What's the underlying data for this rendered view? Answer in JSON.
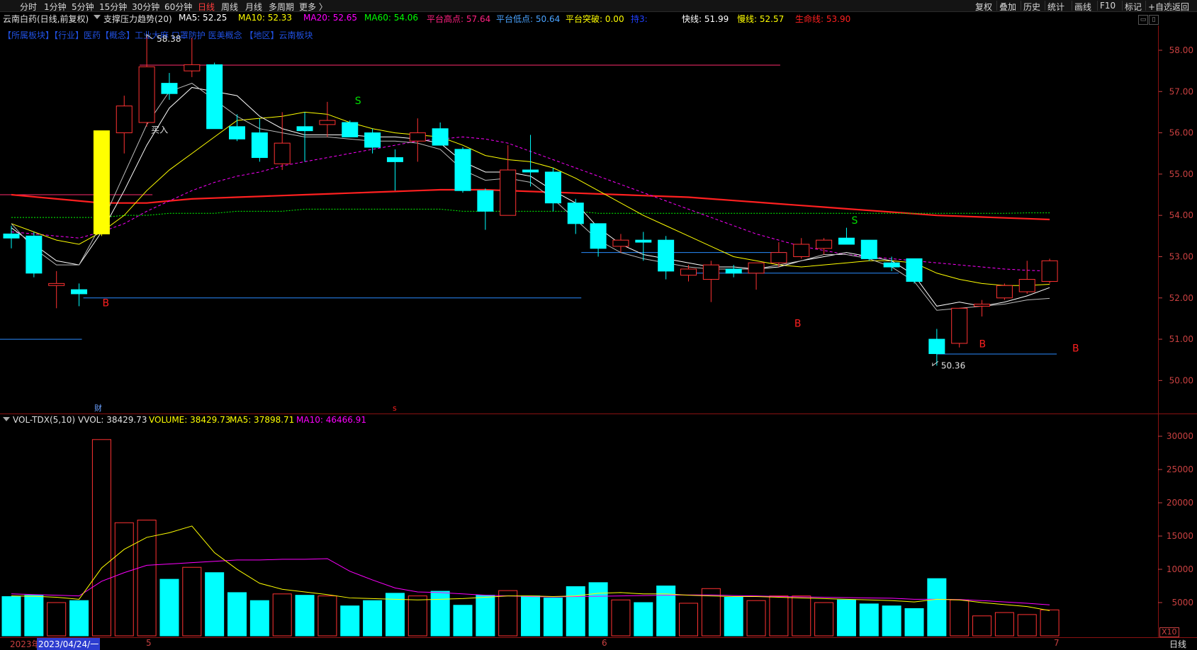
{
  "toolbar": {
    "left": [
      "分时",
      "1分钟",
      "5分钟",
      "15分钟",
      "30分钟",
      "60分钟",
      "日线",
      "周线",
      "月线",
      "多周期",
      "更多 〉"
    ],
    "active": "日线",
    "right": [
      "复权",
      "叠加",
      "历史",
      "统计",
      "画线",
      "F10",
      "标记",
      "+自选",
      "返回"
    ]
  },
  "infobar": {
    "name": "云南白药(日线,前复权)",
    "indicator": "支撑压力趋势(20)",
    "ma5": "MA5: 52.25",
    "ma10": "MA10: 52.33",
    "ma20": "MA20: 52.65",
    "ma60": "MA60: 54.06",
    "plat_high": "平台高点: 57.64",
    "plat_low": "平台低点: 50.64",
    "plat_break": "平台突破: 0.00",
    "extra": "持3:",
    "fast": "快线: 51.99",
    "slow": "慢线: 52.57",
    "life": "生命线: 53.90"
  },
  "tags": "【所属板块】【行业】医药【概念】工业大麻 口罩防护 医美概念 【地区】云南板块",
  "colors": {
    "up": "#ff3232",
    "down": "#00ffff",
    "ma5": "#ffffff",
    "ma10": "#ffff00",
    "ma20": "#ff00ff",
    "ma60": "#00ff00",
    "life": "#ff2020",
    "axis": "#c84040"
  },
  "chart_data": [
    {
      "type": "candlestick",
      "title": "云南白药(日线,前复权)",
      "ylim": [
        49.2,
        58.6
      ],
      "yticks": [
        50.0,
        51.0,
        52.0,
        53.0,
        54.0,
        55.0,
        56.0,
        57.0,
        58.0
      ],
      "candles": [
        {
          "o": 53.55,
          "h": 53.75,
          "l": 53.2,
          "c": 53.45
        },
        {
          "o": 53.5,
          "h": 53.6,
          "l": 52.5,
          "c": 52.6
        },
        {
          "o": 52.3,
          "h": 52.65,
          "l": 51.75,
          "c": 52.35
        },
        {
          "o": 52.2,
          "h": 52.35,
          "l": 51.8,
          "c": 52.1
        },
        {
          "o": 53.55,
          "h": 56.05,
          "l": 53.5,
          "c": 56.05
        },
        {
          "o": 56.0,
          "h": 56.9,
          "l": 55.5,
          "c": 56.65
        },
        {
          "o": 56.25,
          "h": 58.38,
          "l": 56.15,
          "c": 57.6
        },
        {
          "o": 57.2,
          "h": 57.45,
          "l": 56.8,
          "c": 56.95
        },
        {
          "o": 57.5,
          "h": 58.3,
          "l": 57.35,
          "c": 57.65
        },
        {
          "o": 57.65,
          "h": 57.7,
          "l": 56.1,
          "c": 56.1
        },
        {
          "o": 56.15,
          "h": 56.45,
          "l": 55.8,
          "c": 55.85
        },
        {
          "o": 56.0,
          "h": 56.35,
          "l": 55.3,
          "c": 55.4
        },
        {
          "o": 55.25,
          "h": 56.5,
          "l": 55.1,
          "c": 55.75
        },
        {
          "o": 56.15,
          "h": 56.5,
          "l": 55.3,
          "c": 56.05
        },
        {
          "o": 56.2,
          "h": 56.75,
          "l": 55.9,
          "c": 56.3
        },
        {
          "o": 56.25,
          "h": 56.3,
          "l": 55.9,
          "c": 55.9
        },
        {
          "o": 56.0,
          "h": 56.1,
          "l": 55.5,
          "c": 55.65
        },
        {
          "o": 55.4,
          "h": 55.6,
          "l": 54.6,
          "c": 55.3
        },
        {
          "o": 55.8,
          "h": 56.35,
          "l": 55.3,
          "c": 56.0
        },
        {
          "o": 56.1,
          "h": 56.25,
          "l": 55.7,
          "c": 55.7
        },
        {
          "o": 55.6,
          "h": 55.65,
          "l": 54.55,
          "c": 54.6
        },
        {
          "o": 54.6,
          "h": 54.65,
          "l": 53.65,
          "c": 54.1
        },
        {
          "o": 54.0,
          "h": 55.7,
          "l": 54.0,
          "c": 55.1
        },
        {
          "o": 55.1,
          "h": 55.95,
          "l": 54.7,
          "c": 55.05
        },
        {
          "o": 55.05,
          "h": 55.15,
          "l": 54.1,
          "c": 54.3
        },
        {
          "o": 54.3,
          "h": 54.4,
          "l": 53.55,
          "c": 53.8
        },
        {
          "o": 53.8,
          "h": 53.8,
          "l": 53.0,
          "c": 53.2
        },
        {
          "o": 53.25,
          "h": 53.55,
          "l": 53.1,
          "c": 53.4
        },
        {
          "o": 53.4,
          "h": 53.6,
          "l": 52.9,
          "c": 53.35
        },
        {
          "o": 53.4,
          "h": 53.5,
          "l": 52.45,
          "c": 52.65
        },
        {
          "o": 52.55,
          "h": 52.8,
          "l": 52.4,
          "c": 52.7
        },
        {
          "o": 52.45,
          "h": 52.9,
          "l": 51.9,
          "c": 52.8
        },
        {
          "o": 52.7,
          "h": 52.8,
          "l": 52.5,
          "c": 52.6
        },
        {
          "o": 52.6,
          "h": 52.85,
          "l": 52.2,
          "c": 52.85
        },
        {
          "o": 52.85,
          "h": 53.35,
          "l": 52.75,
          "c": 53.1
        },
        {
          "o": 53.0,
          "h": 53.45,
          "l": 52.95,
          "c": 53.3
        },
        {
          "o": 53.2,
          "h": 53.45,
          "l": 53.05,
          "c": 53.4
        },
        {
          "o": 53.45,
          "h": 53.7,
          "l": 53.3,
          "c": 53.3
        },
        {
          "o": 53.4,
          "h": 53.4,
          "l": 52.9,
          "c": 52.95
        },
        {
          "o": 52.85,
          "h": 53.0,
          "l": 52.65,
          "c": 52.75
        },
        {
          "o": 52.95,
          "h": 52.95,
          "l": 52.35,
          "c": 52.4
        },
        {
          "o": 51.0,
          "h": 51.25,
          "l": 50.36,
          "c": 50.65
        },
        {
          "o": 50.9,
          "h": 51.75,
          "l": 50.8,
          "c": 51.75
        },
        {
          "o": 51.8,
          "h": 51.95,
          "l": 51.55,
          "c": 51.85
        },
        {
          "o": 52.0,
          "h": 52.35,
          "l": 51.95,
          "c": 52.3
        },
        {
          "o": 52.15,
          "h": 52.9,
          "l": 52.1,
          "c": 52.45
        },
        {
          "o": 52.4,
          "h": 52.95,
          "l": 52.35,
          "c": 52.9
        }
      ],
      "ma5": [
        53.7,
        53.3,
        52.9,
        52.8,
        53.6,
        54.6,
        55.7,
        56.6,
        57.1,
        57.0,
        56.9,
        56.4,
        56.1,
        55.95,
        55.95,
        55.95,
        55.9,
        55.9,
        55.85,
        55.75,
        55.3,
        55.05,
        55.05,
        54.95,
        54.6,
        54.3,
        53.7,
        53.3,
        53.05,
        52.95,
        52.85,
        52.75,
        52.75,
        52.7,
        52.75,
        52.9,
        53.0,
        53.1,
        53.0,
        52.9,
        52.55,
        51.8,
        51.9,
        51.8,
        51.9,
        52.05,
        52.25
      ],
      "ma10": [
        53.8,
        53.6,
        53.4,
        53.3,
        53.6,
        54.0,
        54.6,
        55.1,
        55.5,
        55.9,
        56.3,
        56.35,
        56.4,
        56.5,
        56.45,
        56.25,
        56.1,
        56.0,
        55.95,
        55.9,
        55.7,
        55.45,
        55.35,
        55.3,
        55.15,
        54.9,
        54.6,
        54.3,
        54.0,
        53.75,
        53.5,
        53.25,
        53.0,
        52.9,
        52.8,
        52.75,
        52.8,
        52.85,
        52.9,
        52.9,
        52.85,
        52.6,
        52.45,
        52.35,
        52.3,
        52.3,
        52.33
      ],
      "ma20": [
        53.6,
        53.55,
        53.5,
        53.45,
        53.6,
        53.8,
        54.1,
        54.35,
        54.6,
        54.8,
        54.95,
        55.05,
        55.2,
        55.3,
        55.4,
        55.5,
        55.6,
        55.7,
        55.8,
        55.85,
        55.9,
        55.85,
        55.75,
        55.55,
        55.35,
        55.15,
        54.95,
        54.75,
        54.55,
        54.35,
        54.15,
        53.95,
        53.75,
        53.55,
        53.4,
        53.25,
        53.15,
        53.05,
        53.0,
        52.95,
        52.9,
        52.85,
        52.8,
        52.75,
        52.7,
        52.67,
        52.65
      ],
      "ma60": [
        53.95,
        53.95,
        53.95,
        53.95,
        53.95,
        54.0,
        54.0,
        54.05,
        54.05,
        54.05,
        54.1,
        54.1,
        54.1,
        54.15,
        54.15,
        54.15,
        54.15,
        54.15,
        54.15,
        54.15,
        54.1,
        54.1,
        54.1,
        54.1,
        54.1,
        54.1,
        54.05,
        54.05,
        54.05,
        54.05,
        54.05,
        54.05,
        54.05,
        54.05,
        54.05,
        54.05,
        54.05,
        54.05,
        54.05,
        54.05,
        54.05,
        54.05,
        54.05,
        54.05,
        54.05,
        54.06,
        54.06
      ],
      "fast": [
        53.8,
        53.2,
        52.8,
        52.8,
        53.8,
        55.0,
        56.2,
        57.0,
        57.2,
        56.8,
        56.4,
        56.1,
        56.0,
        55.9,
        55.9,
        55.85,
        55.8,
        55.8,
        55.75,
        55.6,
        55.1,
        54.85,
        54.9,
        54.8,
        54.4,
        53.9,
        53.4,
        53.1,
        52.95,
        52.85,
        52.75,
        52.7,
        52.7,
        52.7,
        52.8,
        52.9,
        53.05,
        53.05,
        52.95,
        52.75,
        52.4,
        51.7,
        51.75,
        51.8,
        51.85,
        51.95,
        51.99
      ],
      "life": [
        54.5,
        54.45,
        54.4,
        54.35,
        54.3,
        54.3,
        54.3,
        54.35,
        54.4,
        54.42,
        54.44,
        54.46,
        54.48,
        54.5,
        54.52,
        54.54,
        54.56,
        54.58,
        54.6,
        54.62,
        54.62,
        54.62,
        54.6,
        54.58,
        54.56,
        54.54,
        54.52,
        54.5,
        54.48,
        54.46,
        54.44,
        54.4,
        54.36,
        54.32,
        54.28,
        54.24,
        54.2,
        54.16,
        54.12,
        54.08,
        54.04,
        54.0,
        53.98,
        53.96,
        53.94,
        53.92,
        53.9
      ],
      "annotations": {
        "high": "58.38",
        "low": "50.36",
        "buy_text": "买入",
        "b": "B",
        "s": "S",
        "cai": "财",
        "s_red": "s"
      }
    },
    {
      "type": "bar",
      "title": "VOL-TDX(5,10)",
      "ylim": [
        0,
        31500
      ],
      "yticks": [
        5000,
        10000,
        15000,
        20000,
        25000,
        30000
      ],
      "volume": [
        5900,
        6100,
        5000,
        5300,
        29500,
        17000,
        17400,
        8500,
        10300,
        9500,
        6500,
        5300,
        6300,
        6100,
        6000,
        4500,
        5300,
        6400,
        6000,
        6700,
        4600,
        6100,
        6800,
        6000,
        5700,
        7400,
        8000,
        5400,
        5000,
        7500,
        4900,
        7100,
        5800,
        5300,
        6000,
        6000,
        5000,
        5400,
        4800,
        4500,
        4100,
        8600,
        5400,
        3000,
        3500,
        3200,
        3900
      ],
      "ma5": [
        6000,
        5950,
        5800,
        5500,
        10200,
        13000,
        14800,
        15500,
        16500,
        12500,
        10000,
        7900,
        7000,
        6600,
        6200,
        5700,
        5600,
        5500,
        5400,
        5500,
        5600,
        5800,
        6000,
        6000,
        5900,
        6000,
        6400,
        6500,
        6300,
        6300,
        6100,
        6000,
        5900,
        5900,
        5800,
        5700,
        5600,
        5500,
        5400,
        5300,
        5100,
        5500,
        5400,
        5000,
        4700,
        4400,
        3790
      ],
      "ma10": [
        6300,
        6200,
        6100,
        6000,
        8200,
        9500,
        10600,
        10800,
        11000,
        11200,
        11400,
        11400,
        11500,
        11500,
        11600,
        9700,
        8400,
        7200,
        6600,
        6500,
        6300,
        6100,
        6000,
        5900,
        5850,
        5900,
        5950,
        6000,
        6050,
        6100,
        6150,
        6150,
        6050,
        6000,
        5900,
        5850,
        5800,
        5750,
        5700,
        5650,
        5500,
        5500,
        5450,
        5300,
        5100,
        4900,
        4650
      ],
      "info": {
        "name": "VOL-TDX(5,10)",
        "vvol": "VVOL: 38429.73",
        "volume": "VOLUME: 38429.73",
        "ma5": "MA5: 37898.71",
        "ma10": "MA10: 46466.91"
      },
      "unit": "X10"
    }
  ],
  "xaxis": {
    "start": "2023年",
    "date": "2023/04/24/一",
    "m5": "5",
    "m6": "6",
    "m7": "7"
  },
  "period_tab": "日线"
}
